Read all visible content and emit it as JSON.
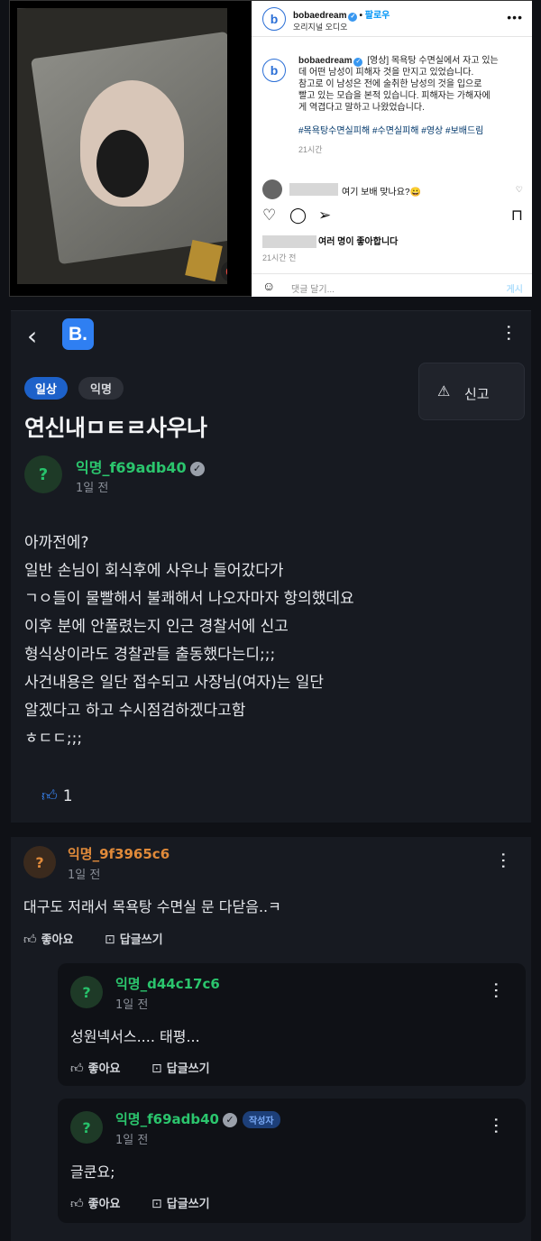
{
  "instagram": {
    "username": "bobaedream",
    "follow_label": "팔로우",
    "audio_label": "오리지널 오디오",
    "caption_user": "bobaedream",
    "caption_line1": "[영상] 목욕탕 수면실에서 자고 있는",
    "caption_line2": "데 어떤 남성이 피해자 것을 만지고 있었습니다.",
    "caption_line3": "참고로 이 남성은 전에 술취한 남성의 것을 입으로",
    "caption_line4": "빨고 있는 모습을 본적 있습니다. 피해자는 가해자에",
    "caption_line5": "게 역겹다고 말하고 나왔었습니다.",
    "hashtags": "#목욕탕수면실피해 #수면실피해 #영상 #보배드림",
    "time_ago": "21시간",
    "comment_text": "여기 보배 맞나요?😀",
    "likes_text": "여러 명이 좋아합니다",
    "likes_time": "21시간 전",
    "comment_placeholder": "댓글 달기...",
    "post_label": "게시"
  },
  "post": {
    "report_label": "신고",
    "tags": [
      "일상",
      "익명"
    ],
    "title": "연신내ㅁㅌㄹ사우나",
    "author": "익명_f69adb40",
    "time": "1일 전",
    "body": [
      "아까전에?",
      "일반 손님이 회식후에 사우나 들어갔다가",
      "ㄱㅇ들이 물빨해서 불쾌해서 나오자마자 항의했데요",
      "이후 분에 안풀렸는지 인근 경찰서에 신고",
      "형식상이라도 경찰관들 출동했다는디;;;",
      "사건내용은 일단 접수되고 사장님(여자)는 일단",
      "알겠다고 하고 수시점검하겠다고함",
      "ㅎㄷㄷ;;;"
    ],
    "like_count": "1"
  },
  "comments": [
    {
      "author": "익명_9f3965c6",
      "time": "1일 전",
      "text": "대구도 저래서 목욕탕 수면실 문 다닫음..ㅋ",
      "like_label": "좋아요",
      "reply_label": "답글쓰기",
      "replies": [
        {
          "author": "익명_d44c17c6",
          "time": "1일 전",
          "text": "성원넥서스.... 태평...",
          "like_label": "좋아요",
          "reply_label": "답글쓰기"
        },
        {
          "author": "익명_f69adb40",
          "badge": "작성자",
          "time": "1일 전",
          "text": "글쿤요;",
          "like_label": "좋아요",
          "reply_label": "답글쓰기"
        }
      ]
    }
  ],
  "colors": {
    "brand": "#2f7ff2",
    "author_green": "#2bc56d",
    "commenter_orange": "#e08a3a",
    "background": "#0f1116"
  },
  "icons": [
    "mute-icon",
    "more-icon",
    "heart-icon",
    "comment-icon",
    "share-icon",
    "bookmark-icon",
    "smile-icon",
    "back-icon",
    "warning-icon",
    "thumb-up-icon",
    "reply-icon"
  ]
}
